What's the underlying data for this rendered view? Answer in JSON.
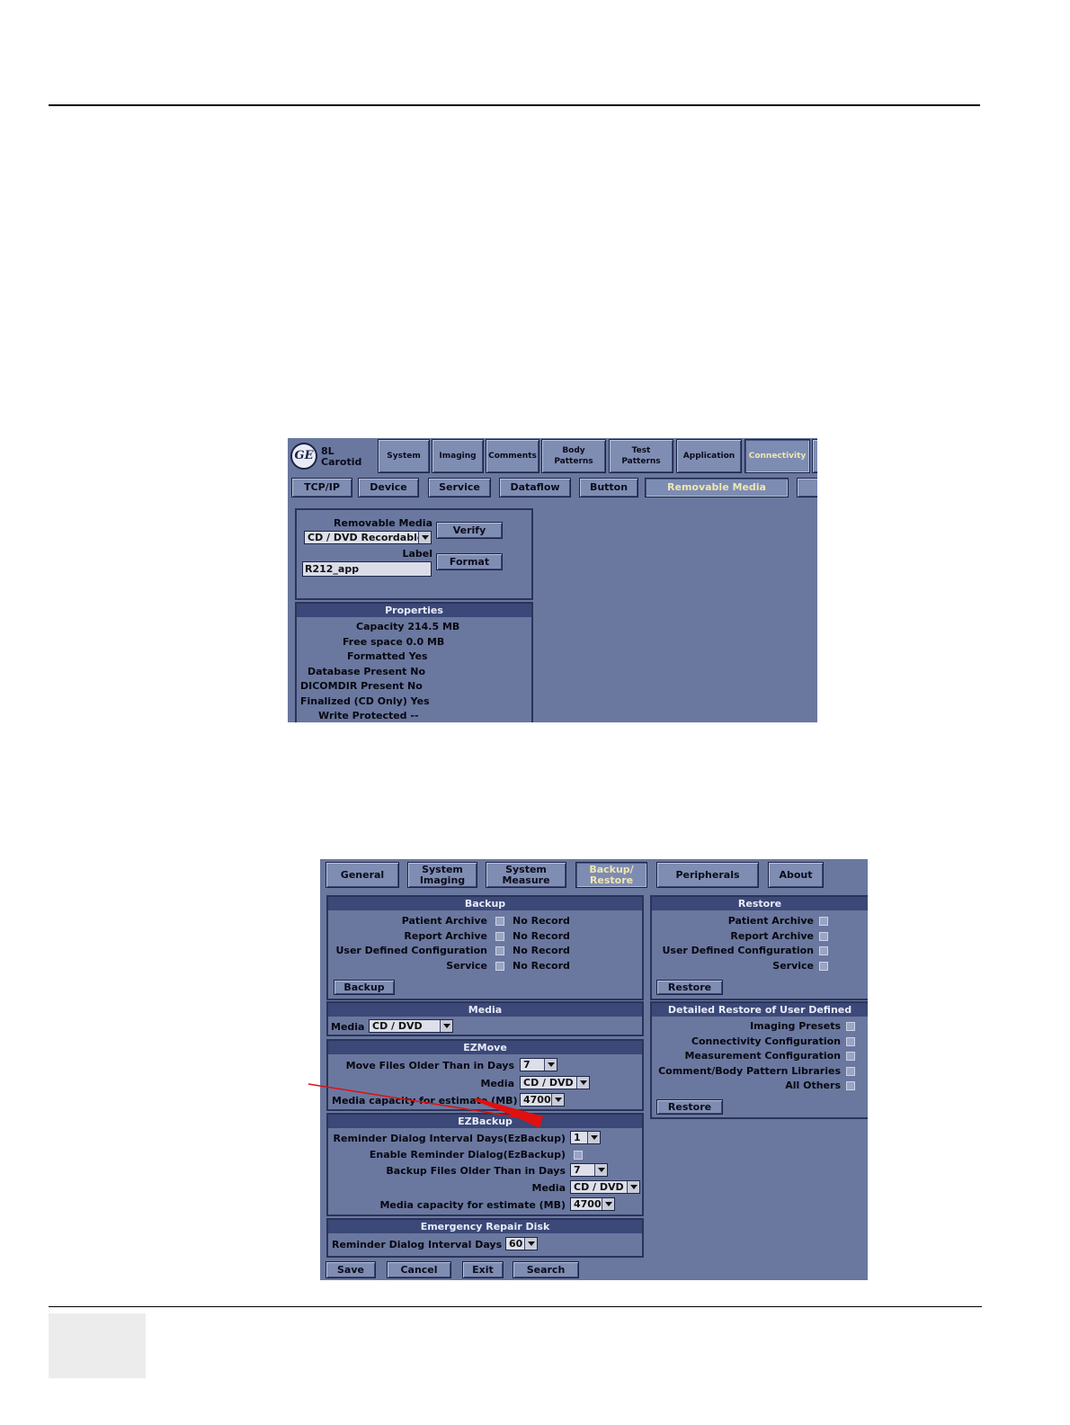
{
  "shot1": {
    "probe": [
      "8L",
      "Carotid"
    ],
    "logo": "GE",
    "main_tabs": [
      "System",
      "Imaging",
      "Comments",
      "Body\nPatterns",
      "Test\nPatterns",
      "Application",
      "Connectivity"
    ],
    "sub_tabs": [
      "TCP/IP",
      "Device",
      "Service",
      "Dataflow",
      "Button",
      "Removable Media"
    ],
    "removable_media_label": "Removable Media",
    "media_value": "CD / DVD Recordable",
    "label_caption": "Label",
    "label_value": "R212_app",
    "verify": "Verify",
    "format": "Format",
    "properties_title": "Properties",
    "properties": [
      "Capacity 214.5 MB",
      "Free space 0.0 MB",
      "Formatted Yes",
      "Database Present No",
      "DICOMDIR Present No",
      "Finalized (CD Only) Yes",
      "Write Protected --"
    ]
  },
  "shot2": {
    "tabs": [
      "General",
      "System\nImaging",
      "System\nMeasure",
      "Backup/\nRestore",
      "Peripherals",
      "About"
    ],
    "backup": {
      "title": "Backup",
      "rows": [
        {
          "label": "Patient Archive",
          "status": "No Record"
        },
        {
          "label": "Report Archive",
          "status": "No Record"
        },
        {
          "label": "User Defined Configuration",
          "status": "No Record"
        },
        {
          "label": "Service",
          "status": "No Record"
        }
      ],
      "button": "Backup"
    },
    "restore": {
      "title": "Restore",
      "rows": [
        "Patient Archive",
        "Report Archive",
        "User Defined Configuration",
        "Service"
      ],
      "button": "Restore"
    },
    "media": {
      "title": "Media",
      "label": "Media",
      "value": "CD / DVD"
    },
    "detailed": {
      "title": "Detailed Restore of User Defined",
      "rows": [
        "Imaging Presets",
        "Connectivity Configuration",
        "Measurement Configuration",
        "Comment/Body Pattern Libraries",
        "All Others"
      ],
      "button": "Restore"
    },
    "ezmove": {
      "title": "EZMove",
      "older_label": "Move Files Older Than in Days",
      "older_value": "7",
      "media_label": "Media",
      "media_value": "CD / DVD",
      "capacity_label": "Media capacity for estimate (MB)",
      "capacity_value": "4700"
    },
    "ezbackup": {
      "title": "EZBackup",
      "interval_label": "Reminder Dialog Interval Days(EzBackup)",
      "interval_value": "1",
      "enable_label": "Enable Reminder Dialog(EzBackup)",
      "older_label": "Backup Files Older Than in Days",
      "older_value": "7",
      "media_label": "Media",
      "media_value": "CD / DVD",
      "capacity_label": "Media capacity for estimate (MB)",
      "capacity_value": "4700"
    },
    "erd": {
      "title": "Emergency Repair Disk",
      "interval_label": "Reminder Dialog Interval Days",
      "interval_value": "60"
    },
    "bottom_buttons": [
      "Save",
      "Cancel",
      "Exit",
      "Search"
    ]
  },
  "colors": {
    "screen_bg": "#6a789f",
    "header_bg": "#3b4878",
    "arrow": "#e01010"
  }
}
